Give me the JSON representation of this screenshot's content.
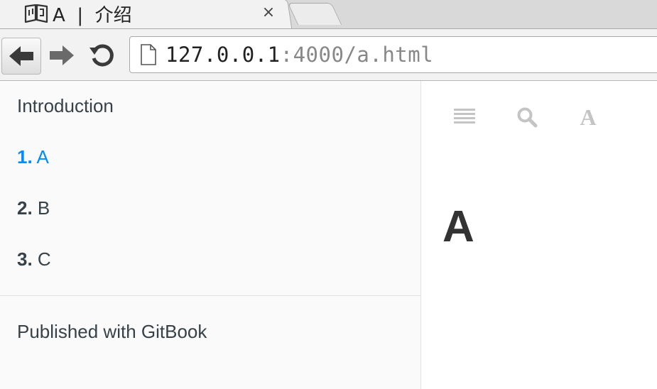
{
  "browser": {
    "tab": {
      "title": "A  |  介绍",
      "close_symbol": "×",
      "favicon": "book-icon"
    },
    "new_tab": "new-tab-button",
    "address": {
      "host": "127.0.0.1",
      "path": ":4000/a.html",
      "page_icon": "page-icon"
    },
    "nav_icons": [
      "back-arrow-icon",
      "forward-arrow-icon",
      "reload-icon"
    ]
  },
  "sidebar": {
    "intro_label": "Introduction",
    "chapters": [
      {
        "number": "1.",
        "label": "A",
        "active": true
      },
      {
        "number": "2.",
        "label": "B",
        "active": false
      },
      {
        "number": "3.",
        "label": "C",
        "active": false
      }
    ],
    "footer_label": "Published with GitBook"
  },
  "content": {
    "toolbar_icons": [
      "menu-icon",
      "search-icon",
      "font-settings-icon"
    ],
    "font_icon_glyph": "A",
    "heading": "A"
  },
  "colors": {
    "active_link": "#008cff",
    "text": "#364149",
    "heading": "#333333",
    "toolbar_icon": "#c4c4c4"
  }
}
